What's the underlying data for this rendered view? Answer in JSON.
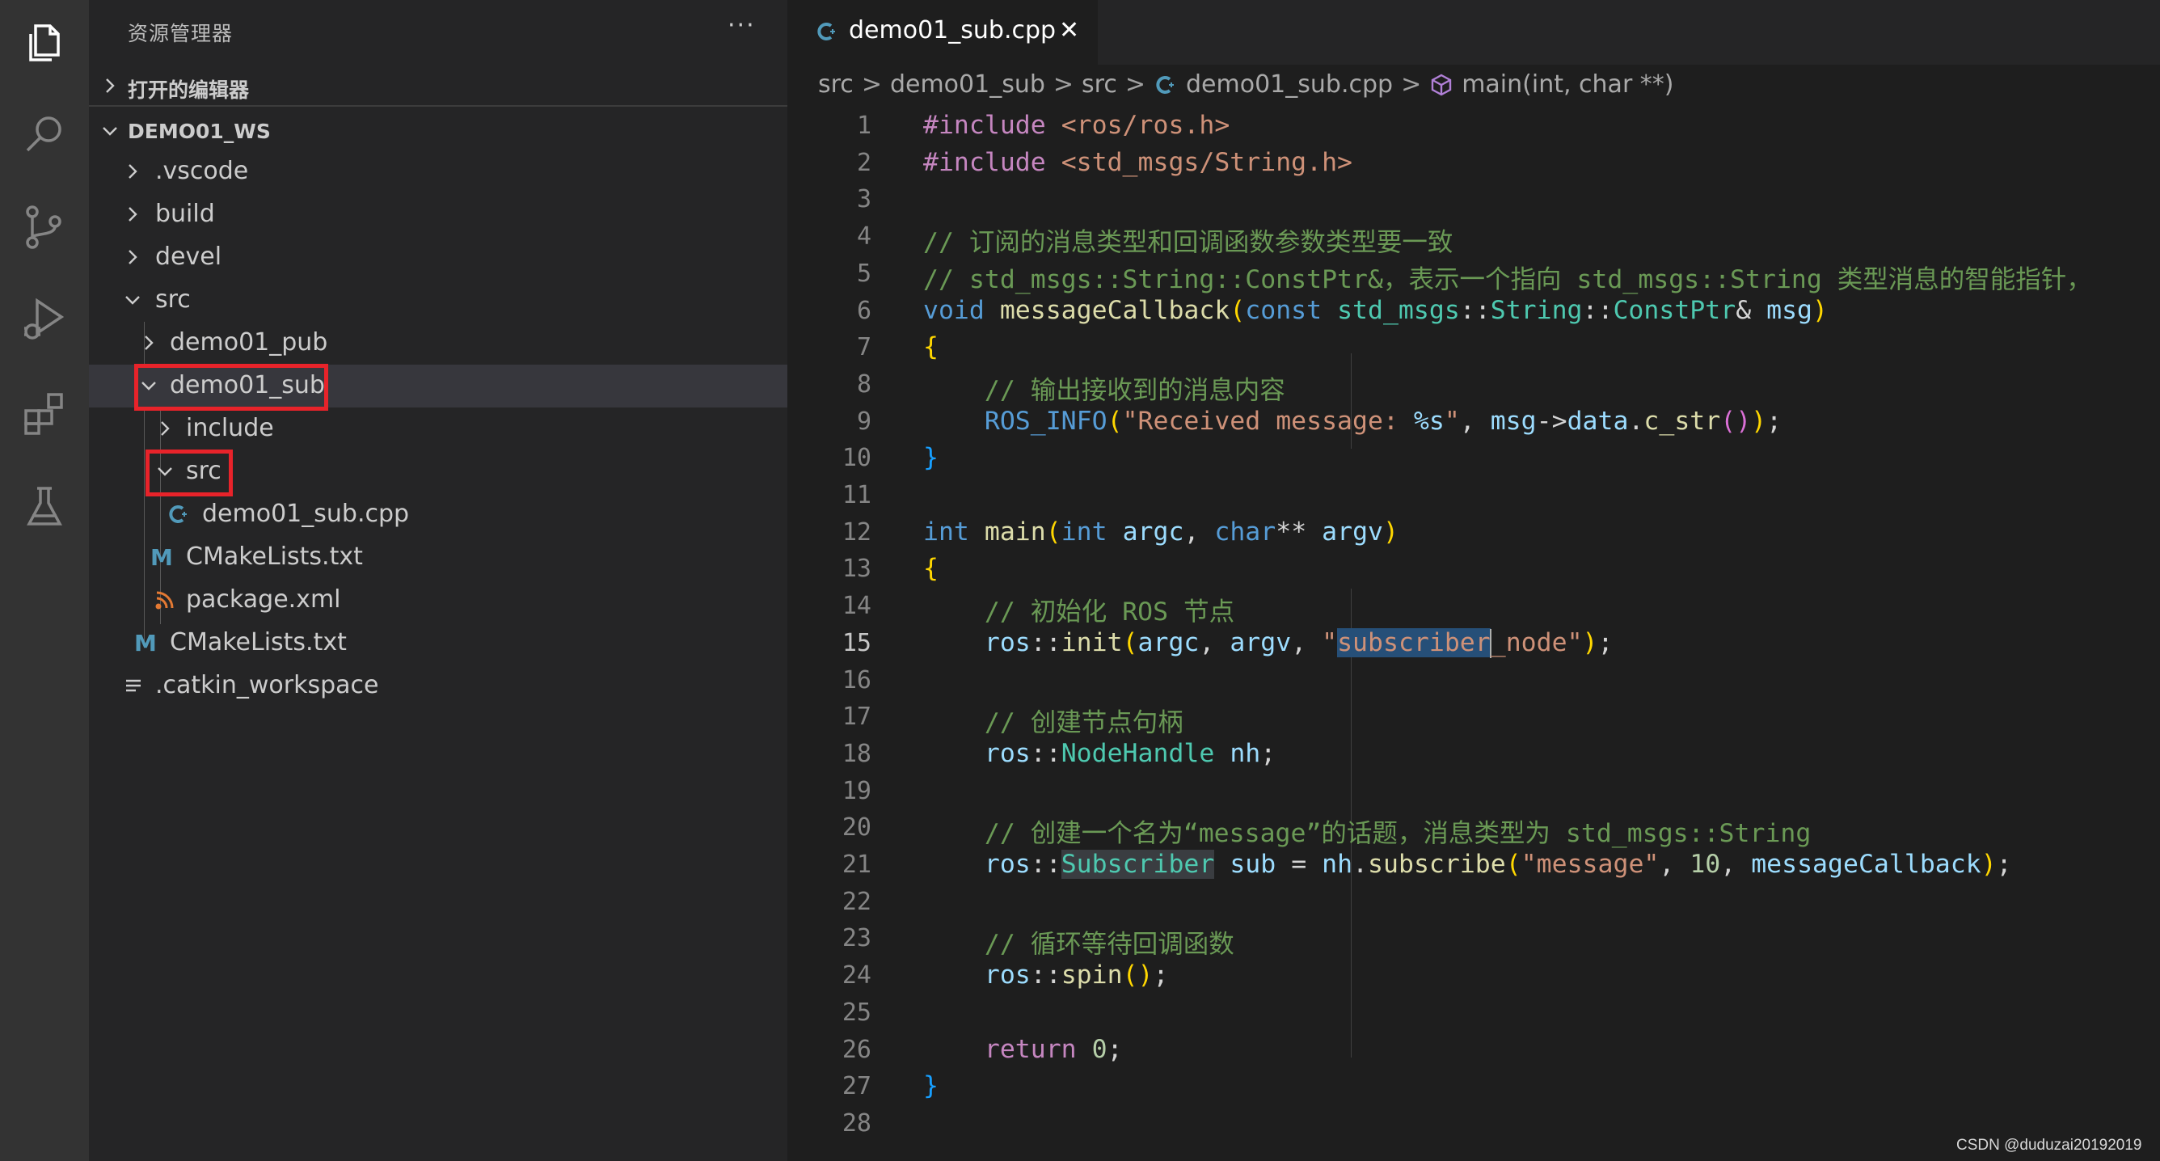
{
  "activity_bar": {
    "icons": [
      "explorer-icon",
      "search-icon",
      "source-control-icon",
      "run-debug-icon",
      "extensions-icon",
      "testing-icon"
    ]
  },
  "sidebar": {
    "title": "资源管理器",
    "more": "···",
    "open_editors_label": "打开的编辑器",
    "workspace_label": "DEMO01_WS",
    "tree": [
      {
        "name": ".vscode",
        "kind": "folder",
        "expanded": false
      },
      {
        "name": "build",
        "kind": "folder",
        "expanded": false
      },
      {
        "name": "devel",
        "kind": "folder",
        "expanded": false
      },
      {
        "name": "src",
        "kind": "folder",
        "expanded": true
      },
      {
        "name": "demo01_pub",
        "kind": "folder",
        "expanded": false
      },
      {
        "name": "demo01_sub",
        "kind": "folder",
        "expanded": true,
        "selected": true
      },
      {
        "name": "include",
        "kind": "folder",
        "expanded": false
      },
      {
        "name": "src",
        "kind": "folder",
        "expanded": true
      },
      {
        "name": "demo01_sub.cpp",
        "kind": "cpp-file"
      },
      {
        "name": "CMakeLists.txt",
        "kind": "cmake-file"
      },
      {
        "name": "package.xml",
        "kind": "xml-file"
      },
      {
        "name": "CMakeLists.txt",
        "kind": "cmake-file"
      },
      {
        "name": ".catkin_workspace",
        "kind": "text-file"
      }
    ],
    "icon_letters": {
      "cmake": "M"
    },
    "jump_glyph": "↳"
  },
  "editor": {
    "tab": {
      "name": "demo01_sub.cpp",
      "close": "✕"
    },
    "breadcrumbs": [
      "src",
      "demo01_sub",
      "src",
      "demo01_sub.cpp",
      "main(int, char **)"
    ],
    "breadcrumb_sep": ">",
    "current_line": 15,
    "lines": [
      "#include <ros/ros.h>",
      "#include <std_msgs/String.h>",
      "",
      "// 订阅的消息类型和回调函数参数类型要一致",
      "// std_msgs::String::ConstPtr&，表示一个指向 std_msgs::String 类型消息的智能指针，",
      "void messageCallback(const std_msgs::String::ConstPtr& msg)",
      "{",
      "    // 输出接收到的消息内容",
      "    ROS_INFO(\"Received message: %s\", msg->data.c_str());",
      "}",
      "",
      "int main(int argc, char** argv)",
      "{",
      "    // 初始化 ROS 节点",
      "    ros::init(argc, argv, \"subscriber_node\");",
      "",
      "    // 创建节点句柄",
      "    ros::NodeHandle nh;",
      "",
      "    // 创建一个名为“message”的话题，消息类型为 std_msgs::String",
      "    ros::Subscriber sub = nh.subscribe(\"message\", 10, messageCallback);",
      "",
      "    // 循环等待回调函数",
      "    ros::spin();",
      "",
      "    return 0;",
      "}",
      ""
    ]
  },
  "watermark": "CSDN @duduzai20192019",
  "colors": {
    "activity_bg": "#333333",
    "sidebar_bg": "#252526",
    "editor_bg": "#1e1e1e",
    "selection_box": "#e8232a",
    "keyword": "#569cd6",
    "comment": "#6a9955",
    "string": "#ce9178",
    "function": "#dcdcaa",
    "type": "#4ec9b0",
    "variable": "#9cdcfe"
  }
}
